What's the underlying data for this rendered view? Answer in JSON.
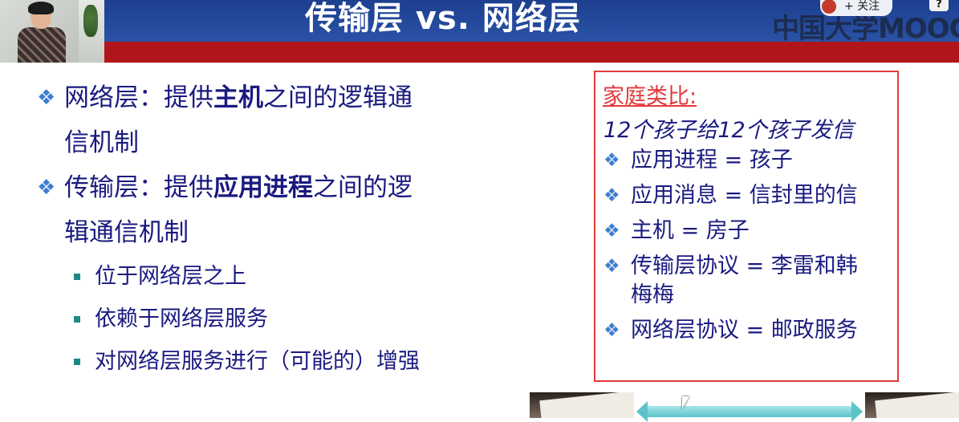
{
  "header": {
    "title": "传输层 vs. 网络层",
    "follow_label": "+ 关注",
    "watermark": "中国大学MOOC",
    "help_label": "?"
  },
  "slide": {
    "bullets": [
      {
        "text_a": "网络层：提供",
        "bold": "主机",
        "text_b": "之间的逻辑通",
        "line2": "信机制"
      },
      {
        "text_a": "传输层：提供",
        "bold": "应用进程",
        "text_b": "之间的逻",
        "line2": "辑通信机制"
      }
    ],
    "sub_bullets": [
      "位于网络层之上",
      "依赖于网络层服务",
      "对网络层服务进行（可能的）增强"
    ]
  },
  "analogy": {
    "title": "家庭类比:",
    "subtitle": "12个孩子给12个孩子发信",
    "items": [
      {
        "line1": "应用进程 = 孩子",
        "line2": ""
      },
      {
        "line1": "应用消息 = 信封里的信",
        "line2": ""
      },
      {
        "line1": "主机 = 房子",
        "line2": ""
      },
      {
        "line1": "传输层协议 = 李雷和韩",
        "line2": "梅梅"
      },
      {
        "line1": "网络层协议 = 邮政服务",
        "line2": ""
      }
    ]
  },
  "colors": {
    "header_blue": "#2a52a6",
    "header_red": "#b0151a",
    "text": "#1a1a80",
    "accent": "#e23a3a",
    "diamond": "#3f7fd0"
  },
  "icons": [
    "diamond-bullet-icon",
    "square-bullet-icon",
    "avatar-icon",
    "help-icon",
    "cursor-icon"
  ]
}
